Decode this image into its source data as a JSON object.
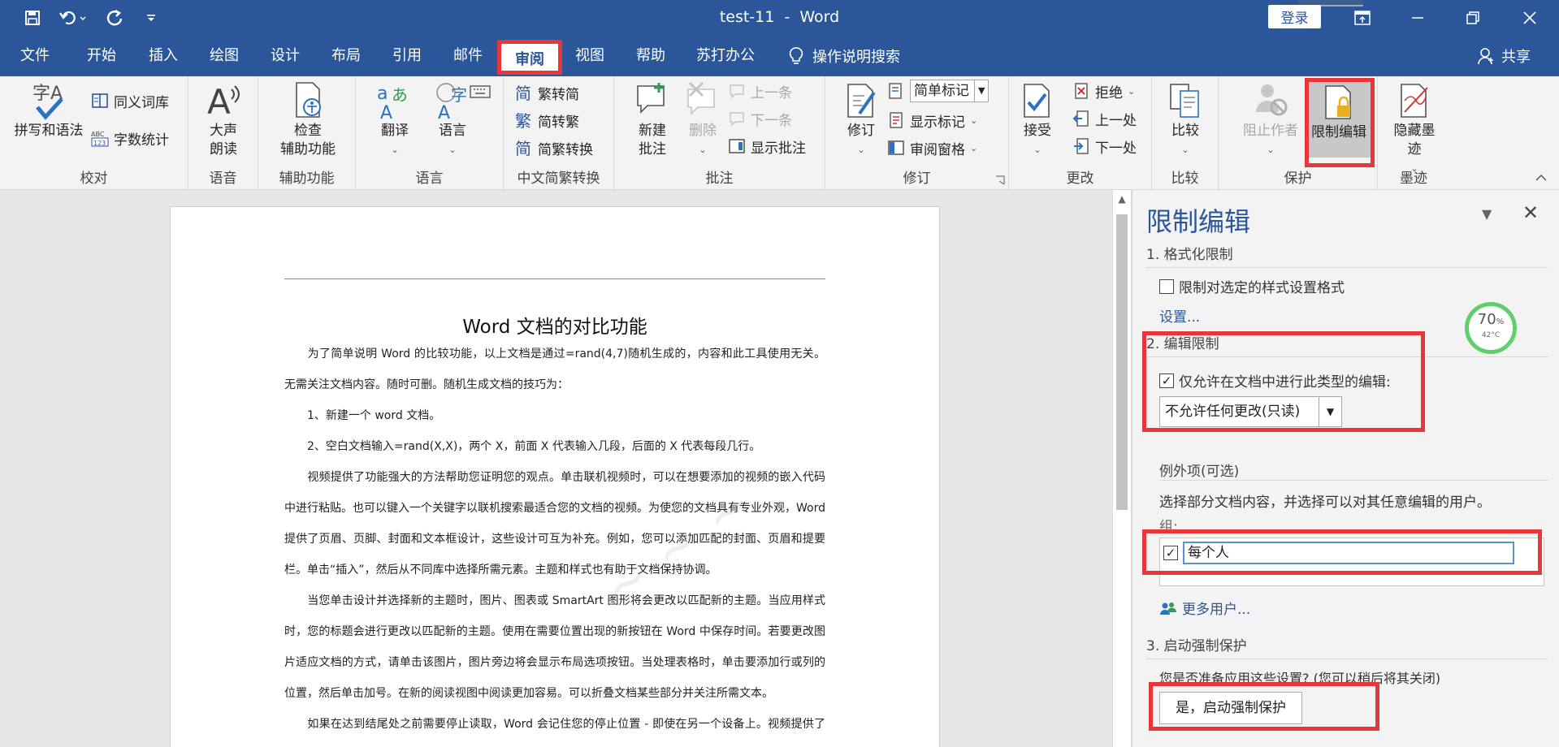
{
  "window": {
    "title": "test-11  -  Word",
    "login": "登录"
  },
  "menu": {
    "tabs": [
      "文件",
      "开始",
      "插入",
      "绘图",
      "设计",
      "布局",
      "引用",
      "邮件",
      "审阅",
      "视图",
      "帮助",
      "苏打办公"
    ],
    "active_tab": "审阅",
    "tell_me": "操作说明搜索",
    "share": "共享"
  },
  "ribbon": {
    "proofing": {
      "label": "校对",
      "spelling": "拼写和语法",
      "thesaurus": "同义词库",
      "word_count": "字数统计"
    },
    "speech": {
      "label": "语音",
      "read_aloud": "大声\n朗读"
    },
    "accessibility": {
      "label": "辅助功能",
      "check": "检查\n辅助功能"
    },
    "language": {
      "label": "语言",
      "translate": "翻译",
      "language": "语言"
    },
    "chinese": {
      "label": "中文简繁转换",
      "to_simplified": "繁转简",
      "to_traditional": "简转繁",
      "convert": "简繁转换"
    },
    "comments": {
      "label": "批注",
      "new": "新建\n批注",
      "delete": "删除",
      "previous": "上一条",
      "next": "下一条",
      "show": "显示批注"
    },
    "tracking": {
      "label": "修订",
      "track": "修订",
      "markup": "简单标记",
      "show_markup": "显示标记",
      "review_pane": "审阅窗格"
    },
    "changes": {
      "label": "更改",
      "accept": "接受",
      "reject": "拒绝",
      "previous": "上一处",
      "next": "下一处"
    },
    "compare": {
      "label": "比较",
      "compare": "比较"
    },
    "protect": {
      "label": "保护",
      "block_authors": "阻止作者",
      "restrict": "限制编辑"
    },
    "ink": {
      "label": "墨迹",
      "hide_ink": "隐藏墨\n迹"
    }
  },
  "document": {
    "heading": "Word 文档的对比功能",
    "paragraphs": [
      "　　为了简单说明 Word 的比较功能，以上文档是通过=rand(4,7)随机生成的，内容和此工具使用无关。无需关注文档内容。随时可删。随机生成文档的技巧为：",
      "　　1、新建一个 word 文档。",
      "　　2、空白文档输入=rand(X,X)，两个 X，前面 X 代表输入几段，后面的 X 代表每段几行。",
      "　　视频提供了功能强大的方法帮助您证明您的观点。单击联机视频时，可以在想要添加的视频的嵌入代码中进行粘贴。也可以键入一个关键字以联机搜索最适合您的文档的视频。为使您的文档具有专业外观，Word 提供了页眉、页脚、封面和文本框设计，这些设计可互为补充。例如，您可以添加匹配的封面、页眉和提要栏。单击“插入”，然后从不同库中选择所需元素。主题和样式也有助于文档保持协调。",
      "　　当您单击设计并选择新的主题时，图片、图表或 SmartArt 图形将会更改以匹配新的主题。当应用样式时，您的标题会进行更改以匹配新的主题。使用在需要位置出现的新按钮在 Word 中保存时间。若要更改图片适应文档的方式，请单击该图片，图片旁边将会显示布局选项按钮。当处理表格时，单击要添加行或列的位置，然后单击加号。在新的阅读视图中阅读更加容易。可以折叠文档某些部分并关注所需文本。",
      "　　如果在达到结尾处之前需要停止读取，Word 会记住您的停止位置 - 即使在另一个设备上。视频提供了功能强大的方法帮助您证明您的观点。单击联机视频时，可以在想要添加的视频的嵌入代码中进行"
    ]
  },
  "pane": {
    "title": "限制编辑",
    "sec1": "1. 格式化限制",
    "format_check": "限制对选定的样式设置格式",
    "settings_link": "设置...",
    "sec2": "2. 编辑限制",
    "edit_check": "仅允许在文档中进行此类型的编辑:",
    "edit_type": "不允许任何更改(只读)",
    "exceptions": "例外项(可选)",
    "exceptions_desc": "选择部分文档内容，并选择可以对其任意编辑的用户。",
    "groups_label": "组:",
    "group_everyone": "每个人",
    "more_users": "更多用户...",
    "sec3": "3. 启动强制保护",
    "enforce_q": "您是否准备应用这些设置? (您可以稍后将其关闭)",
    "enforce_btn": "是，启动强制保护"
  },
  "gauge": {
    "value": "70",
    "unit": "%",
    "temp": "42°C"
  }
}
